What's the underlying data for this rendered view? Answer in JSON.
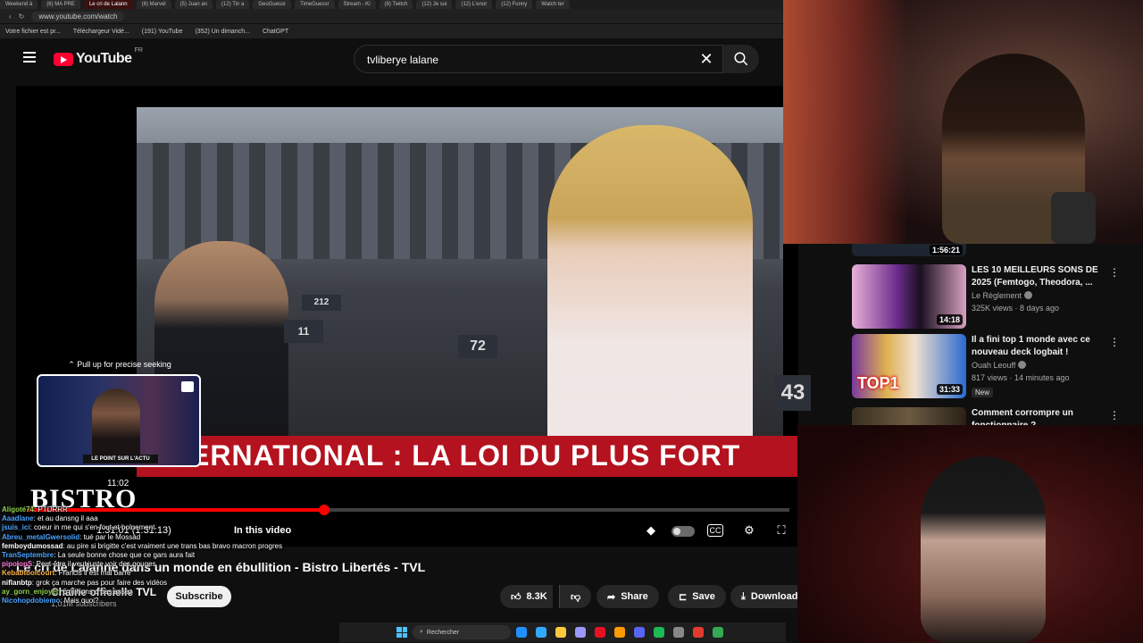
{
  "browser": {
    "tabs": [
      "Weekend à",
      "(6) MA PRE",
      "Le cri de Lalann",
      "(6) Marvel",
      "(5) Juan an",
      "(12) Tin a",
      "GeoGuessr",
      "TimeGuessr",
      "Stream - Ki",
      "(8) Twitch",
      "(12) Je sui",
      "(12) L'enor",
      "(12) Funny",
      "Watch ter"
    ],
    "url": "www.youtube.com/watch",
    "bookmarks": [
      "Votre fichier est pr...",
      "Téléchargeur Vidé...",
      "(191) YouTube",
      "(352) Un dimanch...",
      "ChatGPT"
    ]
  },
  "header": {
    "logo": "YouTube",
    "country": "FR",
    "search_query": "tvliberye lalane"
  },
  "player": {
    "seek_hint": "Pull up for precise seeking",
    "hover_time": "11:02",
    "banner_text": "ERNATIONAL : LA LOI DU PLUS FORT",
    "overlay_logo": "BISTRO",
    "preview_caption": "LE POINT SUR L'ACTU",
    "seat_numbers": [
      "72",
      "43",
      "11",
      "212"
    ],
    "progress": 0.39,
    "timecode": "1:31:01 (1:31:13)",
    "in_this_video": "In this video"
  },
  "video": {
    "title": "Le cri de Lalanne dans un monde en ébullition - Bistro Libertés - TVL",
    "channel": "Chaîne officielle TVL",
    "subscribers": "1,01M subscribers",
    "subscribe_label": "Subscribe",
    "likes": "8.3K",
    "share_label": "Share",
    "save_label": "Save",
    "download_label": "Download"
  },
  "chat": [
    {
      "user": "Aligoté74",
      "color": "#8fd14f",
      "msg": "PTDRRR"
    },
    {
      "user": "Aaadlane",
      "color": "#4aa3ff",
      "msg": "et au dansng il aaa"
    },
    {
      "user": "jsuis_ici",
      "color": "#4aa3ff",
      "msg": "coeur in me qui s'en fout et bolnement"
    },
    {
      "user": "Abreu_metalGwersolid",
      "color": "#4aa3ff",
      "msg": "tué par le Mossad"
    },
    {
      "user": "femboydumossad",
      "color": "#ffffff",
      "msg": "au pire si brigitte c'est vraiment une trans bas bravo macron progres"
    },
    {
      "user": "TranSeptembre",
      "color": "#4aa3ff",
      "msg": "La seule bonne chose que ce gars aura fait"
    },
    {
      "user": "pipolopS",
      "color": "#ff7ad9",
      "msg": "Peut-être il veut juste voir des gouges"
    },
    {
      "user": "Kebabtoolcourt",
      "color": "#ffb347",
      "msg": "Francis il est mal barré"
    },
    {
      "user": "niflanbtp",
      "color": "#ffffff",
      "msg": "grok ça marche pas pour faire des vidéos"
    },
    {
      "user": "ay_gorn_enjoyer",
      "color": "#8fd14f",
      "msg": "6 millions c pas assez"
    },
    {
      "user": "Nicohopdobiemo",
      "color": "#4aa3ff",
      "msg": "Mais quoi?"
    }
  ],
  "taskbar": {
    "search_placeholder": "Rechercher",
    "icon_colors": [
      "#1e90ff",
      "#31a8ff",
      "#ffc83d",
      "#9999ff",
      "#e81123",
      "#ff9a00",
      "#5865f2",
      "#1db954",
      "#888888",
      "#e23b2e",
      "#34a853"
    ]
  },
  "sidebar": {
    "top_duration": "1:56:21",
    "recommendations": [
      {
        "title": "LES 10 MEILLEURS SONS DE 2025 (Femtogo, Theodora, ...",
        "channel": "Le Règlement",
        "meta": "325K views · 8 days ago",
        "duration": "14:18",
        "new": ""
      },
      {
        "title": "Il a fini top 1 monde avec ce nouveau deck logbait !",
        "channel": "Ouah Leouff",
        "meta": "817 views · 14 minutes ago",
        "duration": "31:33",
        "new": "New"
      },
      {
        "title": "Comment corrompre un fonctionnaire ?",
        "channel": "",
        "meta": "",
        "duration": "",
        "new": ""
      }
    ]
  },
  "colors": {
    "accent": "#ff0033",
    "banner": "#b3121e",
    "background": "#0f0f0f"
  }
}
